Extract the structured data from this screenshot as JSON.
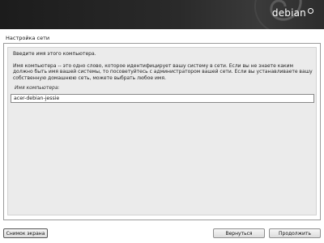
{
  "header": {
    "logo_text": "debian"
  },
  "page": {
    "section_title": "Настройка сети"
  },
  "question": {
    "prompt": "Введите имя этого компьютера.",
    "description": "Имя компьютера -- это одно слово, которое идентифицирует вашу систему в сети. Если вы не знаете каким должно быть имя вашей системы, то посоветуйтесь с администратором вашей сети. Если вы устанавливаете вашу собственную домашнюю сеть, можете выбрать любое имя.",
    "field_label": "Имя компьютера:",
    "hostname_value": "acer-debian-jessie"
  },
  "footer": {
    "screenshot_label": "Снимок экрана",
    "back_label": "Вернуться",
    "continue_label": "Продолжить"
  },
  "colors": {
    "banner": "#2b2b2b",
    "dialog_bg": "#ebebeb",
    "page_bg": "#ffffff"
  }
}
